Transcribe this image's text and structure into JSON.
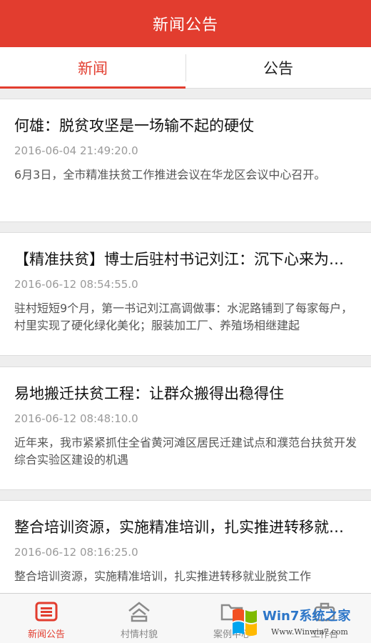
{
  "header": {
    "title": "新闻公告"
  },
  "tabs": [
    {
      "label": "新闻",
      "active": true
    },
    {
      "label": "公告",
      "active": false
    }
  ],
  "news": [
    {
      "title": "何雄：脱贫攻坚是一场输不起的硬仗",
      "time": "2016-06-04 21:49:20.0",
      "summary": "6月3日，全市精准扶贫工作推进会议在华龙区会议中心召开。"
    },
    {
      "title": "【精准扶贫】博士后驻村书记刘江：沉下心来为农民办实事",
      "time": "2016-06-12 08:54:55.0",
      "summary": "驻村短短9个月，第一书记刘江高调做事：水泥路铺到了每家每户，村里实现了硬化绿化美化；服装加工厂、养殖场相继建起"
    },
    {
      "title": "易地搬迁扶贫工程：让群众搬得出稳得住",
      "time": "2016-06-12 08:48:10.0",
      "summary": "近年来，我市紧紧抓住全省黄河滩区居民迁建试点和濮范台扶贫开发综合实验区建设的机遇"
    },
    {
      "title": "整合培训资源，实施精准培训，扎实推进转移就业脱贫",
      "time": "2016-06-12 08:16:25.0",
      "summary": "整合培训资源，实施精准培训，扎实推进转移就业脱贫工作"
    }
  ],
  "tabbar": [
    {
      "label": "新闻公告",
      "icon": "news-icon",
      "active": true
    },
    {
      "label": "村情村貌",
      "icon": "village-icon",
      "active": false
    },
    {
      "label": "案例中心",
      "icon": "folder-icon",
      "active": false
    },
    {
      "label": "工作台",
      "icon": "workbench-icon",
      "active": false
    }
  ],
  "watermark": {
    "title": "Win7系统之家",
    "url": "Www.Winwin7.com"
  },
  "colors": {
    "accent": "#e23d2f",
    "background": "#eeeeee",
    "watermark_blue": "#2d76c8"
  }
}
